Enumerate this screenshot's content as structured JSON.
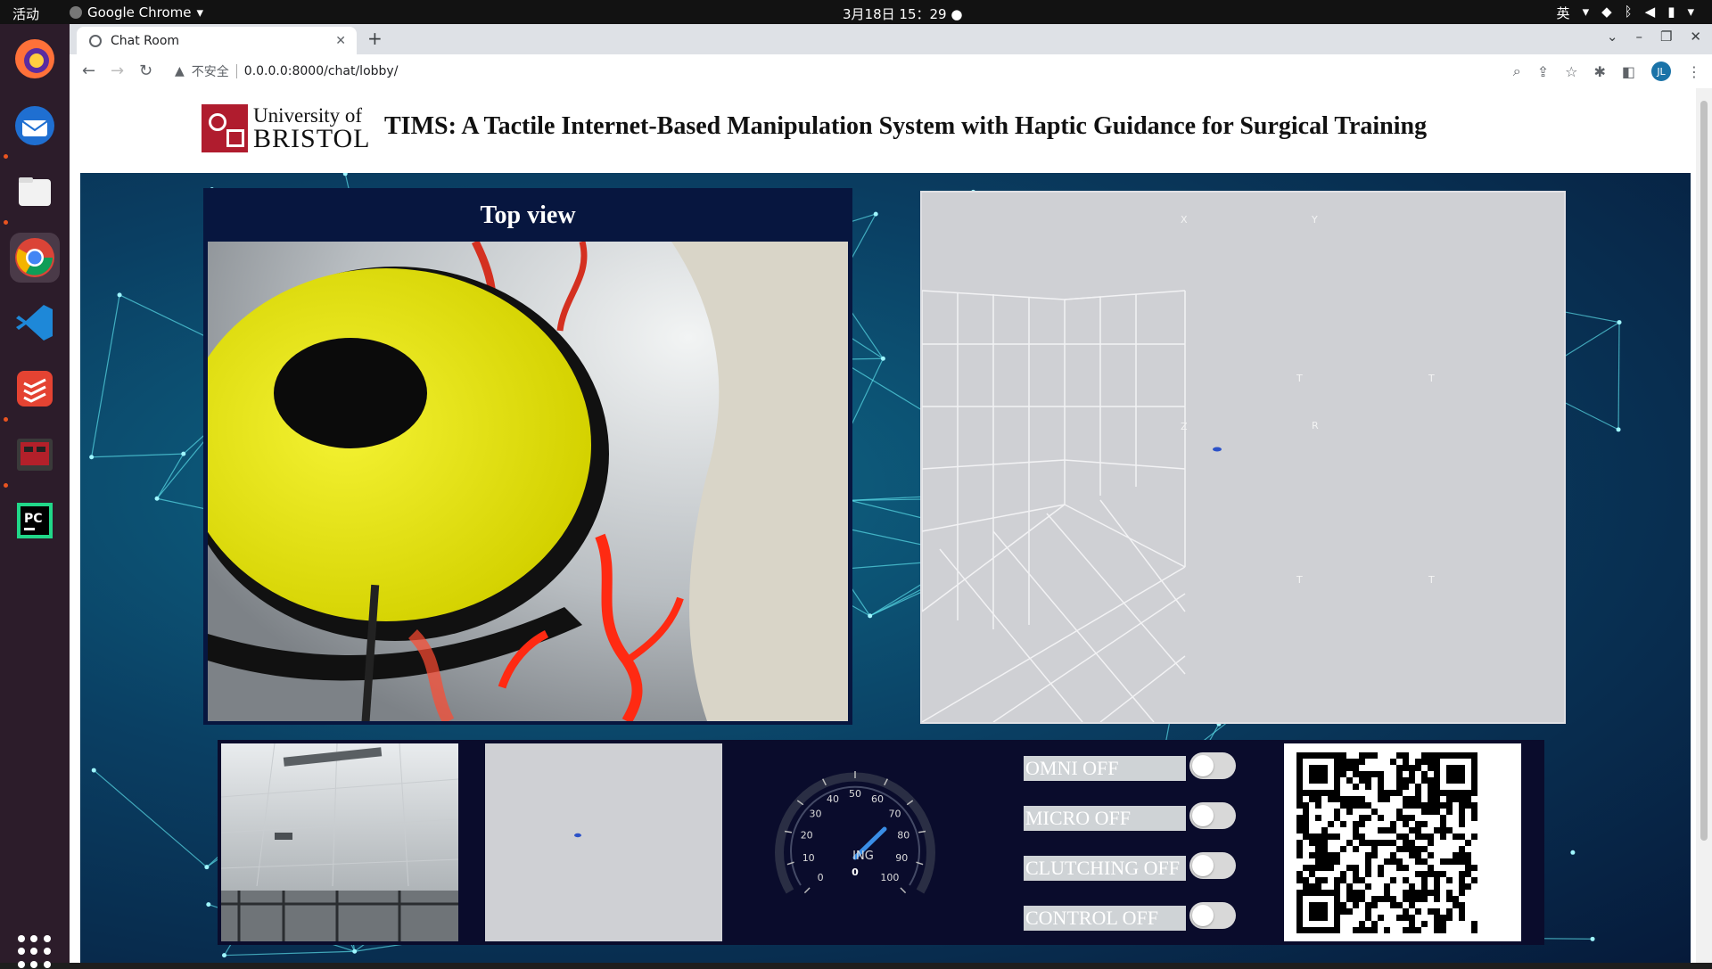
{
  "system": {
    "activities": "活动",
    "app_name": "Google Chrome",
    "clock": "3月18日  15：29",
    "input_method": "英"
  },
  "dock": {
    "icons": [
      "firefox-icon",
      "thunderbird-icon",
      "files-icon",
      "chrome-icon",
      "vscode-icon",
      "todoist-icon",
      "terminal-app-icon",
      "pycharm-icon",
      "show-apps-icon"
    ]
  },
  "browser": {
    "tab_title": "Chat Room",
    "not_secure": "不安全",
    "url": "0.0.0.0:8000/chat/lobby/",
    "profile_initials": "JL"
  },
  "header": {
    "logo_line1": "University of",
    "logo_line2": "BRISTOL",
    "title": "TIMS: A Tactile Internet-Based Manipulation System with Haptic Guidance for Surgical Training"
  },
  "top_view": {
    "title": "Top view"
  },
  "plot3d": {
    "axis_labels": [
      "X",
      "Y",
      "T",
      "T",
      "R",
      "T",
      "T",
      "Z"
    ]
  },
  "gauge": {
    "label": "ING",
    "value": "0",
    "ticks": [
      "0",
      "10",
      "20",
      "30",
      "40",
      "50",
      "60",
      "70",
      "80",
      "90",
      "100"
    ],
    "value_numeric": 0
  },
  "toggles": [
    {
      "label": "OMNI OFF",
      "on": false
    },
    {
      "label": "MICRO OFF",
      "on": false
    },
    {
      "label": "CLUTCHING OFF",
      "on": false
    },
    {
      "label": "CONTROL OFF",
      "on": false
    }
  ]
}
